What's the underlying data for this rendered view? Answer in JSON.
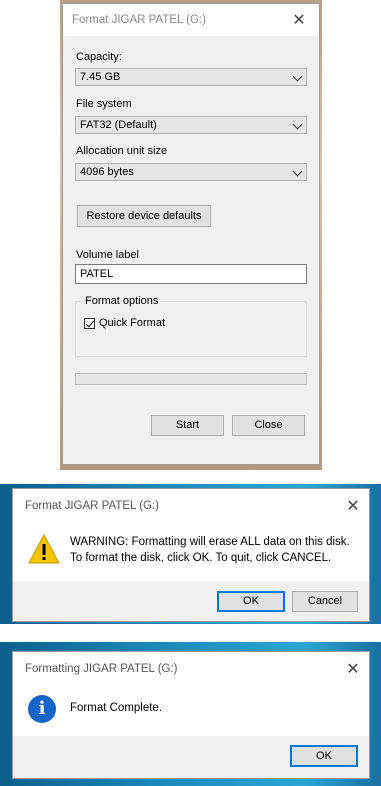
{
  "format_dialog": {
    "title": "Format JIGAR PATEL (G:)",
    "capacity_label": "Capacity:",
    "capacity_value": "7.45 GB",
    "filesystem_label": "File system",
    "filesystem_value": "FAT32 (Default)",
    "allocation_label": "Allocation unit size",
    "allocation_value": "4096 bytes",
    "restore_button": "Restore device defaults",
    "volume_label": "Volume label",
    "volume_value": "PATEL",
    "format_options_label": "Format options",
    "quick_format_label": "Quick Format",
    "quick_format_checked": true,
    "progress": 0,
    "start_button": "Start",
    "close_button": "Close",
    "close_glyph": "✕"
  },
  "warning_dialog": {
    "title": "Format JIGAR PATEL (G:)",
    "message_line1": "WARNING: Formatting will erase ALL data on this disk.",
    "message_line2": "To format the disk, click OK. To quit, click CANCEL.",
    "ok_button": "OK",
    "cancel_button": "Cancel",
    "icon": "warning-icon",
    "close_glyph": "✕"
  },
  "complete_dialog": {
    "title": "Formatting JIGAR PATEL (G:)",
    "message": "Format Complete.",
    "ok_button": "OK",
    "icon": "info-icon",
    "close_glyph": "✕"
  },
  "colors": {
    "accent": "#0078d7",
    "dialog_bg": "#f0f0f0",
    "warning_yellow": "#f5c400",
    "info_blue": "#1565c8"
  }
}
